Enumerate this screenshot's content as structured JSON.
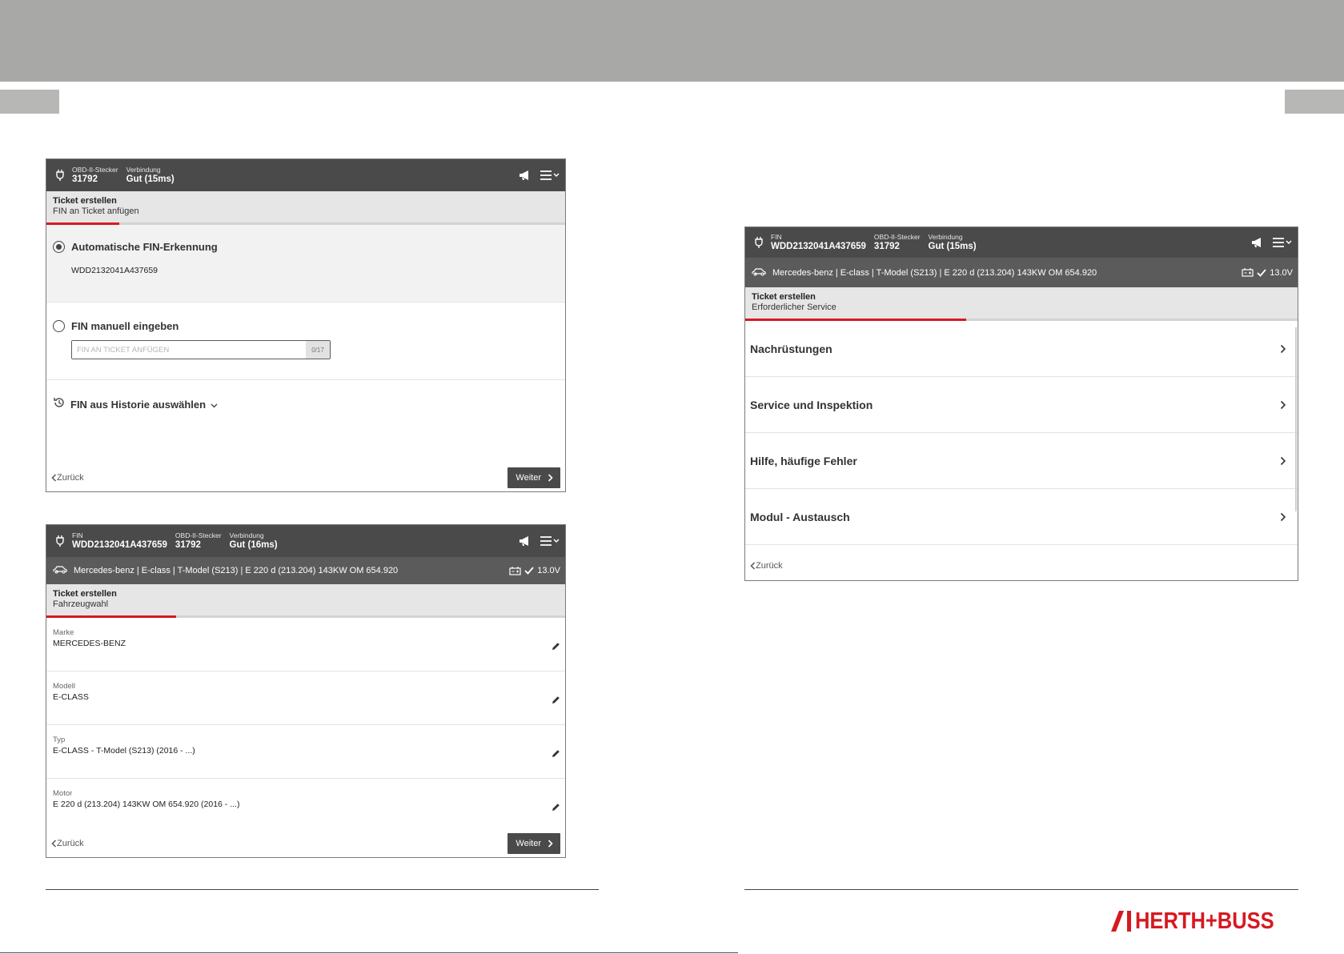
{
  "brand": {
    "logo_text": "HERTH+BUSS",
    "accent_color": "#d71921",
    "dark_color": "#4a4a4a"
  },
  "screen1": {
    "topbar": {
      "obd_label": "OBD-II-Stecker",
      "obd_value": "31792",
      "connection_label": "Verbindung",
      "connection_value": "Gut (15ms)"
    },
    "ticket": {
      "title": "Ticket erstellen",
      "subtitle": "FIN an Ticket anfügen",
      "progress": 0.14
    },
    "auto_option": {
      "label": "Automatische FIN-Erkennung",
      "selected": true,
      "detected_fin": "WDD2132041A437659"
    },
    "manual_option": {
      "label": "FIN manuell eingeben",
      "selected": false,
      "input_placeholder": "FIN AN TICKET ANFÜGEN",
      "input_value": "",
      "counter": "0/17"
    },
    "history_option": {
      "label": "FIN aus Historie auswählen"
    },
    "footer": {
      "back_label": "Zurück",
      "next_label": "Weiter"
    }
  },
  "screen2": {
    "topbar": {
      "fin_label": "FIN",
      "fin_value": "WDD2132041A437659",
      "obd_label": "OBD-II-Stecker",
      "obd_value": "31792",
      "connection_label": "Verbindung",
      "connection_value": "Gut (16ms)"
    },
    "vehicle": {
      "description": "Mercedes-benz | E-class | T-Model (S213) | E 220 d (213.204) 143KW OM 654.920",
      "voltage": "13.0V"
    },
    "ticket": {
      "title": "Ticket erstellen",
      "subtitle": "Fahrzeugwahl",
      "progress": 0.25
    },
    "fields": [
      {
        "label": "Marke",
        "value": "MERCEDES-BENZ"
      },
      {
        "label": "Modell",
        "value": "E-CLASS"
      },
      {
        "label": "Typ",
        "value": "E-CLASS - T-Model (S213) (2016 - ...)"
      },
      {
        "label": "Motor",
        "value": "E 220 d (213.204) 143KW OM 654.920 (2016 - ...)"
      }
    ],
    "footer": {
      "back_label": "Zurück",
      "next_label": "Weiter"
    }
  },
  "screen3": {
    "topbar": {
      "fin_label": "FIN",
      "fin_value": "WDD2132041A437659",
      "obd_label": "OBD-II-Stecker",
      "obd_value": "31792",
      "connection_label": "Verbindung",
      "connection_value": "Gut (15ms)"
    },
    "vehicle": {
      "description": "Mercedes-benz | E-class | T-Model (S213) | E 220 d (213.204) 143KW OM 654.920",
      "voltage": "13.0V"
    },
    "ticket": {
      "title": "Ticket erstellen",
      "subtitle": "Erforderlicher Service",
      "progress": 0.4
    },
    "menu": [
      {
        "label": "Nachrüstungen"
      },
      {
        "label": "Service und Inspektion"
      },
      {
        "label": "Hilfe, häufige Fehler"
      },
      {
        "label": "Modul - Austausch"
      }
    ],
    "footer": {
      "back_label": "Zurück"
    }
  }
}
